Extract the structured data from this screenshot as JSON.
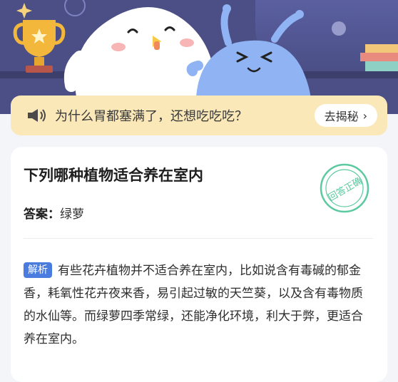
{
  "banner": {
    "text": "为什么胃都塞满了，还想吃吃吃？",
    "button_label": "去揭秘",
    "button_chevron": "›"
  },
  "card": {
    "question": "下列哪种植物适合养在室内",
    "answer_label": "答案：",
    "answer_value": "绿萝",
    "stamp_text": "回答正确",
    "explain_tag": "解析",
    "explain_text": "有些花卉植物并不适合养在室内，比如说含有毒碱的郁金香，耗氧性花卉夜来香，易引起过敏的天竺葵，以及含有毒物质的水仙等。而绿萝四季常绿，还能净化环境，利大于弊，更适合养在室内。"
  },
  "colors": {
    "hero_bg": "#4b4f86",
    "banner_bg": "#fbe8b8",
    "tag_bg": "#4a7ce0",
    "stamp": "#5cc9a0"
  }
}
